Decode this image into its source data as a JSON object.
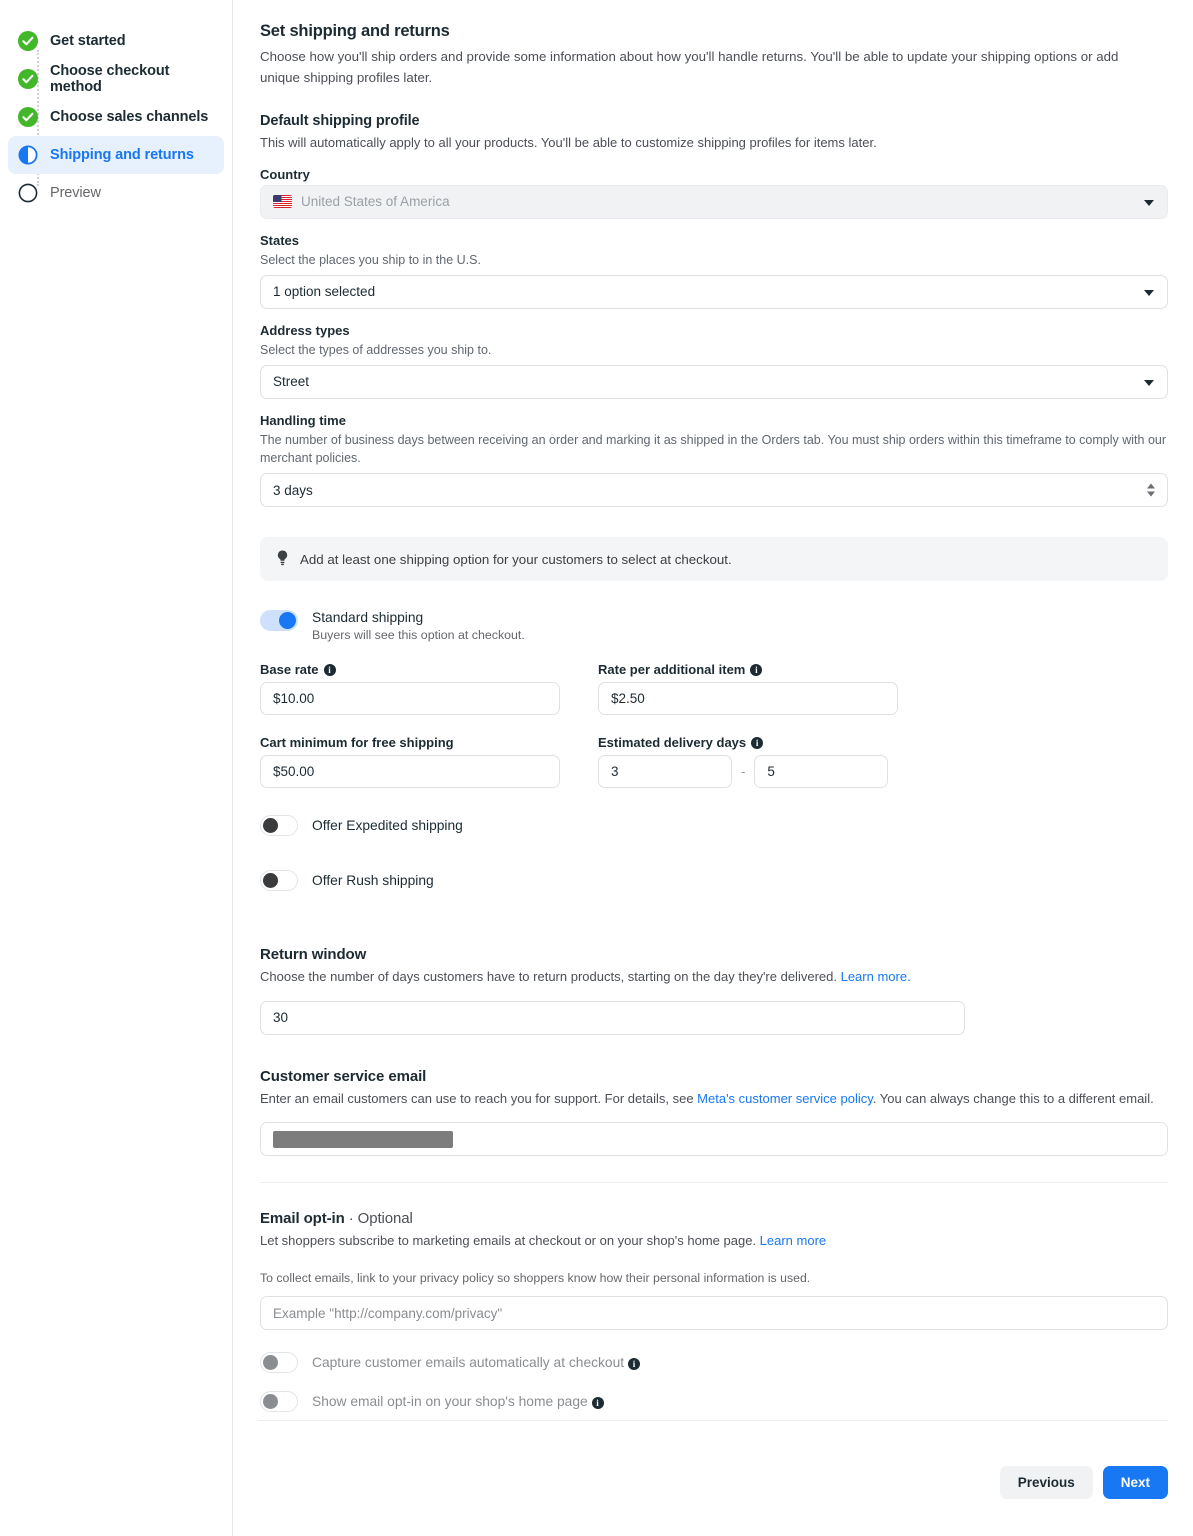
{
  "sidebar": {
    "items": [
      {
        "label": "Get started",
        "state": "complete",
        "icon": "check-circle-icon"
      },
      {
        "label": "Choose checkout method",
        "state": "complete",
        "icon": "check-circle-icon"
      },
      {
        "label": "Choose sales channels",
        "state": "complete",
        "icon": "check-circle-icon"
      },
      {
        "label": "Shipping and returns",
        "state": "active",
        "icon": "half-circle-icon"
      },
      {
        "label": "Preview",
        "state": "pending",
        "icon": "empty-circle-icon"
      }
    ]
  },
  "header": {
    "title": "Set shipping and returns",
    "description": "Choose how you'll ship orders and provide some information about how you'll handle returns. You'll be able to update your shipping options or add unique shipping profiles later."
  },
  "default_profile": {
    "heading": "Default shipping profile",
    "description": "This will automatically apply to all your products. You'll be able to customize shipping profiles for items later.",
    "country": {
      "label": "Country",
      "value": "United States of America",
      "flag": "us-flag-icon",
      "disabled": true
    },
    "states": {
      "label": "States",
      "help": "Select the places you ship to in the U.S.",
      "value": "1 option selected"
    },
    "address_types": {
      "label": "Address types",
      "help": "Select the types of addresses you ship to.",
      "value": "Street"
    },
    "handling_time": {
      "label": "Handling time",
      "help": "The number of business days between receiving an order and marking it as shipped in the Orders tab. You must ship orders within this timeframe to comply with our merchant policies.",
      "value": "3 days"
    }
  },
  "banner": {
    "icon": "lightbulb-icon",
    "text": "Add at least one shipping option for your customers to select at checkout."
  },
  "standard_shipping": {
    "title": "Standard shipping",
    "subtitle": "Buyers will see this option at checkout.",
    "enabled": true,
    "base_rate": {
      "label": "Base rate",
      "value": "$10.00",
      "has_info": true
    },
    "rate_per_additional_item": {
      "label": "Rate per additional item",
      "value": "$2.50",
      "has_info": true
    },
    "cart_minimum": {
      "label": "Cart minimum for free shipping",
      "value": "$50.00",
      "has_info": false
    },
    "estimated_delivery_days": {
      "label": "Estimated delivery days",
      "min": "3",
      "max": "5",
      "separator": "-",
      "has_info": true
    }
  },
  "expedited_shipping": {
    "label": "Offer Expedited shipping",
    "enabled": false
  },
  "rush_shipping": {
    "label": "Offer Rush shipping",
    "enabled": false
  },
  "return_window": {
    "heading": "Return window",
    "description": "Choose the number of days customers have to return products, starting on the day they're delivered.",
    "link_text": "Learn more.",
    "value": "30"
  },
  "customer_service_email": {
    "heading": "Customer service email",
    "description_pre": "Enter an email customers can use to reach you for support. For details, see ",
    "link_text": "Meta's customer service policy",
    "description_post": ". You can always change this to a different email.",
    "value_redacted": true
  },
  "email_optin": {
    "heading": "Email opt-in",
    "heading_optional": "· Optional",
    "description": "Let shoppers subscribe to marketing emails at checkout or on your shop's home page.",
    "link_text": "Learn more",
    "privacy_help": "To collect emails, link to your privacy policy so shoppers know how their personal information is used.",
    "privacy_placeholder": "Example \"http://company.com/privacy\"",
    "privacy_value": "",
    "capture_toggle": {
      "label": "Capture customer emails automatically at checkout",
      "enabled": false,
      "disabled": true,
      "has_info": true
    },
    "show_toggle": {
      "label": "Show email opt-in on your shop's home page",
      "enabled": false,
      "disabled": true,
      "has_info": true
    }
  },
  "footer": {
    "previous_label": "Previous",
    "next_label": "Next"
  },
  "colors": {
    "accent": "#1877f2",
    "complete": "#42b72a",
    "text": "#1c2b33",
    "muted": "#65676b",
    "active_bg": "#e7f0fd"
  }
}
